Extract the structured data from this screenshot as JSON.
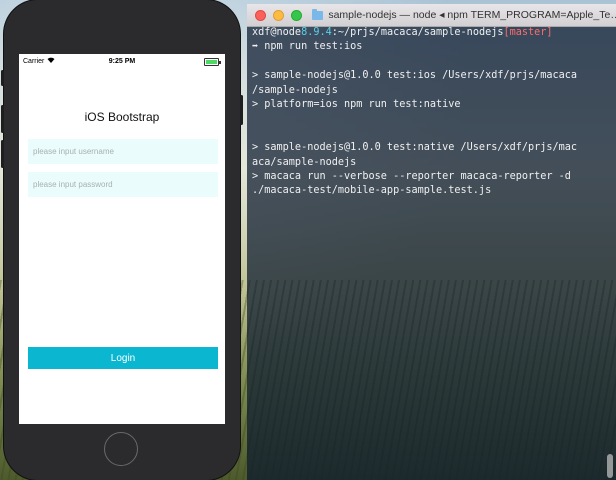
{
  "phone": {
    "status": {
      "carrier": "Carrier",
      "time": "9:25 PM",
      "battery_level": 1.0
    },
    "app": {
      "title": "iOS Bootstrap",
      "username_placeholder": "please input username",
      "password_placeholder": "please input password",
      "login_label": "Login"
    }
  },
  "terminal": {
    "window_title": "sample-nodejs — node ◂ npm TERM_PROGRAM=Apple_Te…",
    "prompt": {
      "user_host": "xdf@node",
      "node_version": "8.9.4",
      "path": ":~/prjs/macaca/sample-nodejs",
      "branch": "[master]"
    },
    "lines": [
      "➡ npm run test:ios",
      "",
      "> sample-nodejs@1.0.0 test:ios /Users/xdf/prjs/macaca",
      "/sample-nodejs",
      "> platform=ios npm run test:native",
      "",
      "",
      "> sample-nodejs@1.0.0 test:native /Users/xdf/prjs/mac",
      "aca/sample-nodejs",
      "> macaca run --verbose --reporter macaca-reporter -d",
      "./macaca-test/mobile-app-sample.test.js"
    ]
  },
  "colors": {
    "login_button": "#0bb7d0",
    "input_background": "#eafcfc",
    "prompt_cyan": "#5ad1e6",
    "branch_red": "#ff6b6b"
  }
}
